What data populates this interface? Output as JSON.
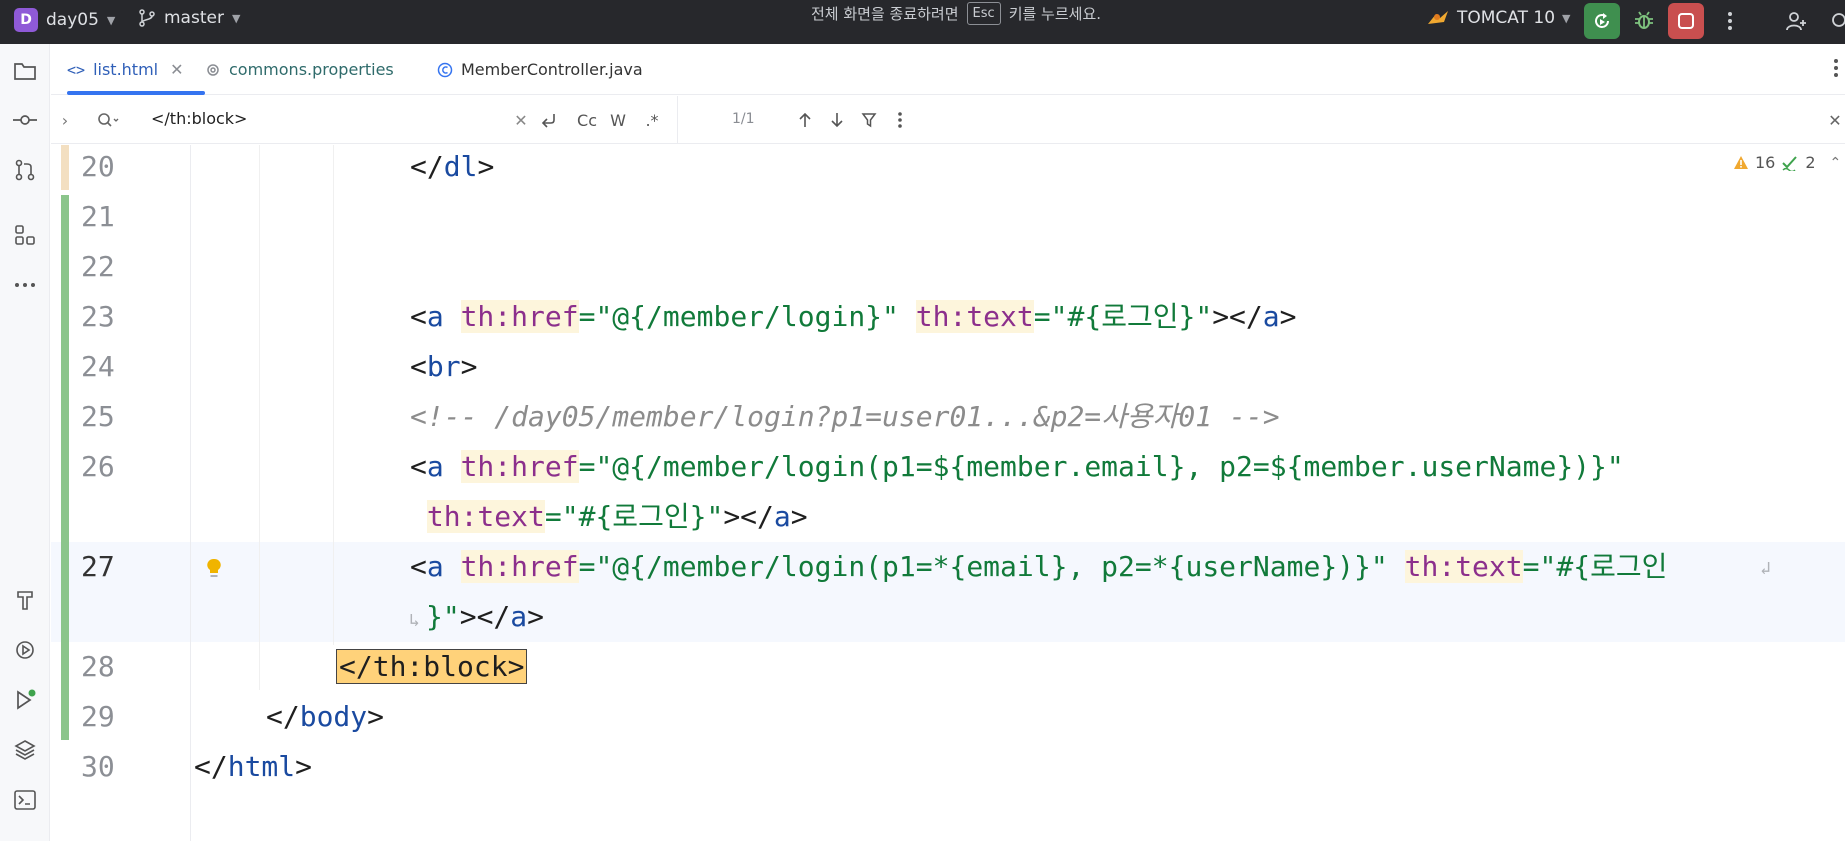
{
  "titlebar": {
    "project_badge": "D",
    "project_name": "day05",
    "branch": "master",
    "fullscreen_msg_pre": "전체 화면을 종료하려면",
    "fullscreen_key": "Esc",
    "fullscreen_msg_post": "키를 누르세요.",
    "run_config": "TOMCAT 10"
  },
  "tabs": [
    {
      "label": "list.html",
      "active": true
    },
    {
      "label": "commons.properties",
      "active": false
    },
    {
      "label": "MemberController.java",
      "active": false
    }
  ],
  "find": {
    "query": "</th:block>",
    "match_case": "Cc",
    "words": "W",
    "regex": ".*",
    "count": "1/1"
  },
  "inspections": {
    "warnings": "16",
    "typos": "2"
  },
  "editor": {
    "line_numbers": [
      "20",
      "21",
      "22",
      "23",
      "24",
      "25",
      "26",
      "27",
      "28",
      "29",
      "30"
    ],
    "lines": {
      "l20": [
        "</",
        "dl",
        ">"
      ],
      "l23": [
        "<",
        "a",
        " ",
        "th:href",
        "=",
        "\"@{/member/login}\"",
        " ",
        "th:text",
        "=",
        "\"#{로그인}\"",
        "></",
        "a",
        ">"
      ],
      "l24": [
        "<",
        "br",
        ">"
      ],
      "l25": "<!-- /day05/member/login?p1=user01...&p2=사용자01 -->",
      "l26a": [
        "<",
        "a",
        " ",
        "th:href",
        "=",
        "\"@{/member/login(p1=${member.email}, p2=${member.userName})}\""
      ],
      "l26b": [
        " ",
        "th:text",
        "=",
        "\"#{로그인}\"",
        "></",
        "a",
        ">"
      ],
      "l27a": [
        "<",
        "a",
        " ",
        "th:href",
        "=",
        "\"@{/member/login(p1=*{email}, p2=*{userName})}\"",
        " ",
        "th:text",
        "=",
        "\"#{로그인"
      ],
      "l27b": [
        "}\"",
        "></",
        "a",
        ">"
      ],
      "l28": "</th:block>",
      "l29": [
        "</",
        "body",
        ">"
      ],
      "l30": [
        "</",
        "html",
        ">"
      ]
    }
  }
}
